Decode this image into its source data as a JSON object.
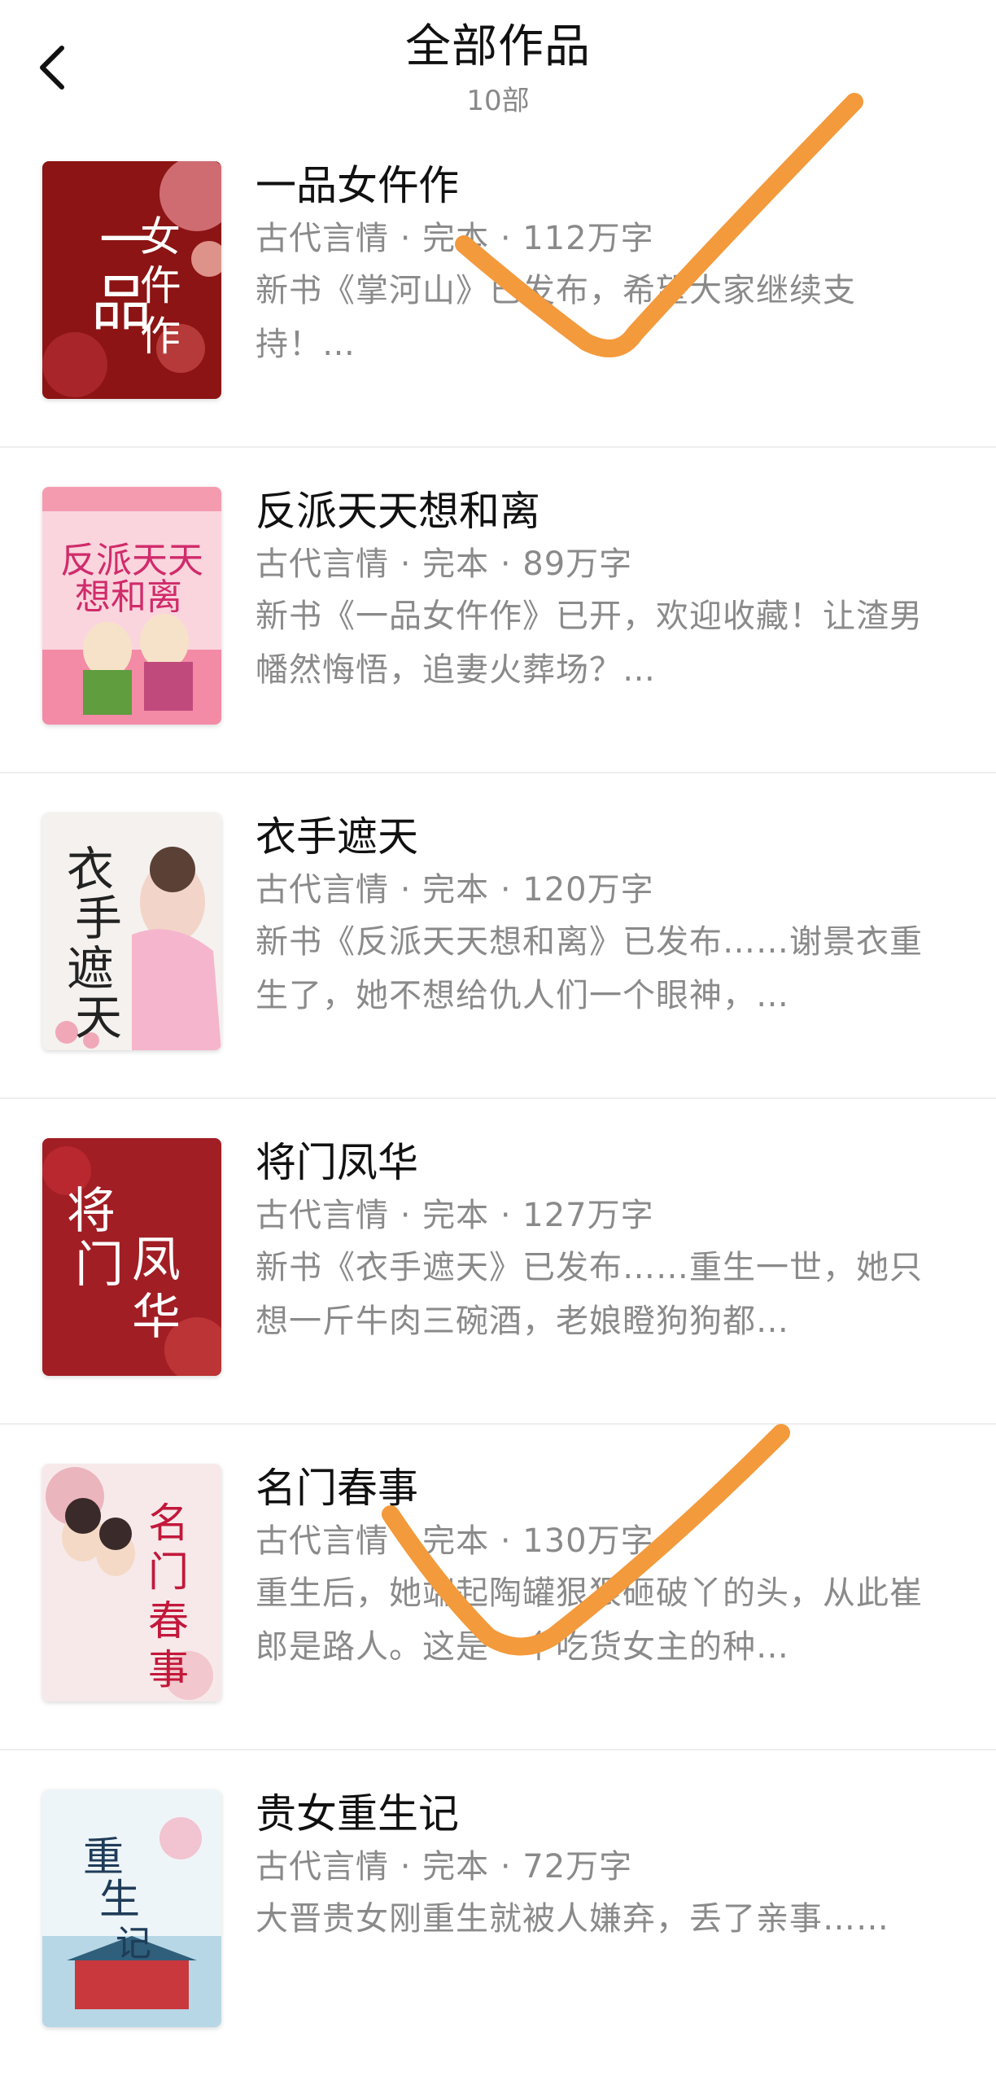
{
  "header": {
    "title": "全部作品",
    "count": "10部"
  },
  "books": [
    {
      "title": "一品女仵作",
      "meta": "古代言情 · 完本 · 112万字",
      "desc": "新书《掌河山》已发布，希望大家继续支持！…",
      "cover_text": "一品女仵作"
    },
    {
      "title": "反派天天想和离",
      "meta": "古代言情 · 完本 · 89万字",
      "desc": "新书《一品女仵作》已开，欢迎收藏！让渣男幡然悔悟，追妻火葬场？…",
      "cover_text": "反派天天想和离"
    },
    {
      "title": "衣手遮天",
      "meta": "古代言情 · 完本 · 120万字",
      "desc": "新书《反派天天想和离》已发布……谢景衣重生了，她不想给仇人们一个眼神，…",
      "cover_text": "衣手遮天"
    },
    {
      "title": "将门凤华",
      "meta": "古代言情 · 完本 · 127万字",
      "desc": "新书《衣手遮天》已发布……重生一世，她只想一斤牛肉三碗酒，老娘瞪狗狗都…",
      "cover_text": "将门凤华"
    },
    {
      "title": "名门春事",
      "meta": "古代言情 · 完本 · 130万字",
      "desc": "重生后，她端起陶罐狠狠砸破丫的头，从此崔郎是路人。这是一个吃货女主的种…",
      "cover_text": "名门春事"
    },
    {
      "title": "贵女重生记",
      "meta": "古代言情 · 完本 · 72万字",
      "desc": "大晋贵女刚重生就被人嫌弃，丢了亲事……",
      "cover_text": "重生记"
    }
  ],
  "colors": {
    "accent_mark": "#f39a3c",
    "meta_text": "#8a8a8a"
  }
}
